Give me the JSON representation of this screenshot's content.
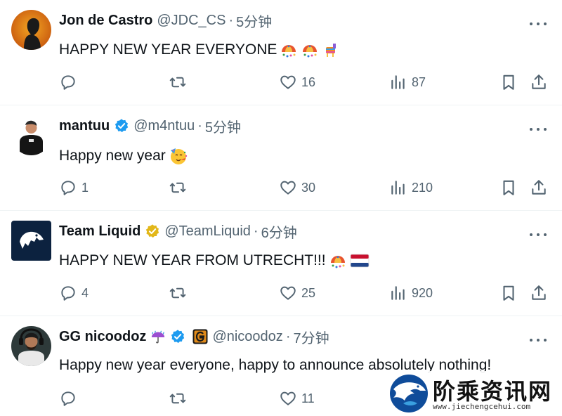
{
  "tweets": [
    {
      "name": "Jon de Castro",
      "handle": "@JDC_CS",
      "separator": "·",
      "time": "5分钟",
      "verified": false,
      "text": "HAPPY NEW YEAR EVERYONE",
      "emojis": [
        "confetti-ball-icon",
        "confetti-ball-icon",
        "pinata-icon"
      ],
      "replies": "",
      "retweets": "",
      "likes": "16",
      "views": "87"
    },
    {
      "name": "mantuu",
      "handle": "@m4ntuu",
      "separator": "·",
      "time": "5分钟",
      "verified": true,
      "verified_color": "#1d9bf0",
      "text": "Happy new year",
      "emojis": [
        "partying-face-icon"
      ],
      "replies": "1",
      "retweets": "",
      "likes": "30",
      "views": "210"
    },
    {
      "name": "Team Liquid",
      "handle": "@TeamLiquid",
      "separator": "·",
      "time": "6分钟",
      "verified": true,
      "verified_color": "#e2b719",
      "text": "HAPPY NEW YEAR FROM UTRECHT!!!",
      "emojis": [
        "confetti-ball-icon",
        "netherlands-flag-icon"
      ],
      "replies": "4",
      "retweets": "",
      "likes": "25",
      "views": "920"
    },
    {
      "name": "GG nicoodoz",
      "handle": "@nicoodoz",
      "separator": "·",
      "time": "7分钟",
      "verified": true,
      "verified_color": "#1d9bf0",
      "text": "Happy new year everyone, happy to announce absolutely nothing!",
      "emojis": [],
      "replies": "",
      "retweets": "",
      "likes": "11",
      "views": ""
    }
  ],
  "watermark": {
    "title": "阶乘资讯网",
    "url": "www.jiechengcehui.com"
  },
  "colors": {
    "text_primary": "#0f1419",
    "text_secondary": "#536471",
    "divider": "#eff3f4",
    "verified_blue": "#1d9bf0",
    "verified_gold": "#e2b719"
  }
}
